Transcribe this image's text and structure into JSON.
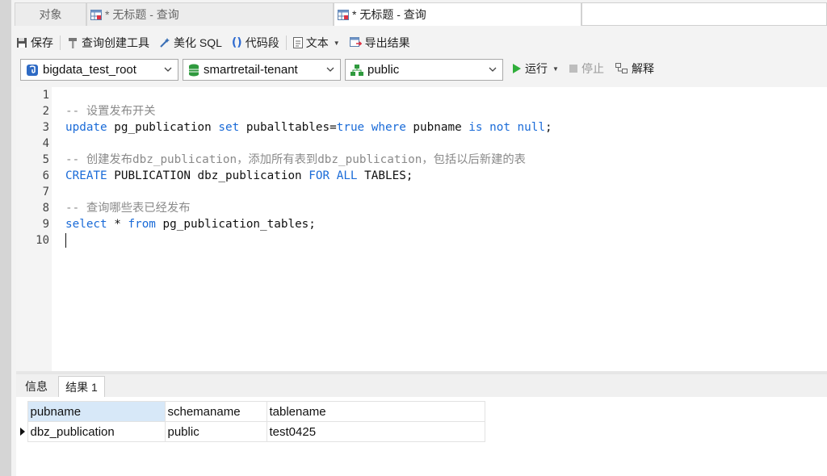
{
  "tabs": {
    "objects_label": "对象",
    "query_tab_1": "* 无标题 - 查询",
    "query_tab_2": "* 无标题 - 查询"
  },
  "toolbar": {
    "save": "保存",
    "query_builder": "查询创建工具",
    "beautify_sql": "美化 SQL",
    "code_snippet": "代码段",
    "text": "文本",
    "export_results": "导出结果"
  },
  "connection": {
    "connection_name": "bigdata_test_root",
    "database": "smartretail-tenant",
    "schema": "public",
    "run": "运行",
    "stop": "停止",
    "explain": "解释"
  },
  "editor": {
    "line_numbers": [
      "1",
      "2",
      "3",
      "4",
      "5",
      "6",
      "7",
      "8",
      "9",
      "10"
    ],
    "lines": {
      "l2": "-- 设置发布开关",
      "l3_kw1": "update",
      "l3_t1": " pg_publication ",
      "l3_kw2": "set",
      "l3_t2": " puballtables=",
      "l3_kw3": "true",
      "l3_t3": " ",
      "l3_kw4": "where",
      "l3_t4": " pubname ",
      "l3_kw5": "is not null",
      "l3_t5": ";",
      "l5": "-- 创建发布dbz_publication，添加所有表到dbz_publication，包括以后新建的表",
      "l6_kw1": "CREATE",
      "l6_t1": " PUBLICATION dbz_publication ",
      "l6_kw2": "FOR ALL",
      "l6_t2": " TABLES;",
      "l8": "-- 查询哪些表已经发布",
      "l9_kw1": "select",
      "l9_t1": " * ",
      "l9_kw2": "from",
      "l9_t2": " pg_publication_tables;"
    }
  },
  "results": {
    "tab_info": "信息",
    "tab_result": "结果 1",
    "columns": [
      "pubname",
      "schemaname",
      "tablename"
    ],
    "rows": [
      [
        "dbz_publication",
        "public",
        "test0425"
      ]
    ]
  },
  "colors": {
    "keyword": "#1a6bd8",
    "comment": "#8a8a8a",
    "selected_header": "#d7e8f8"
  }
}
